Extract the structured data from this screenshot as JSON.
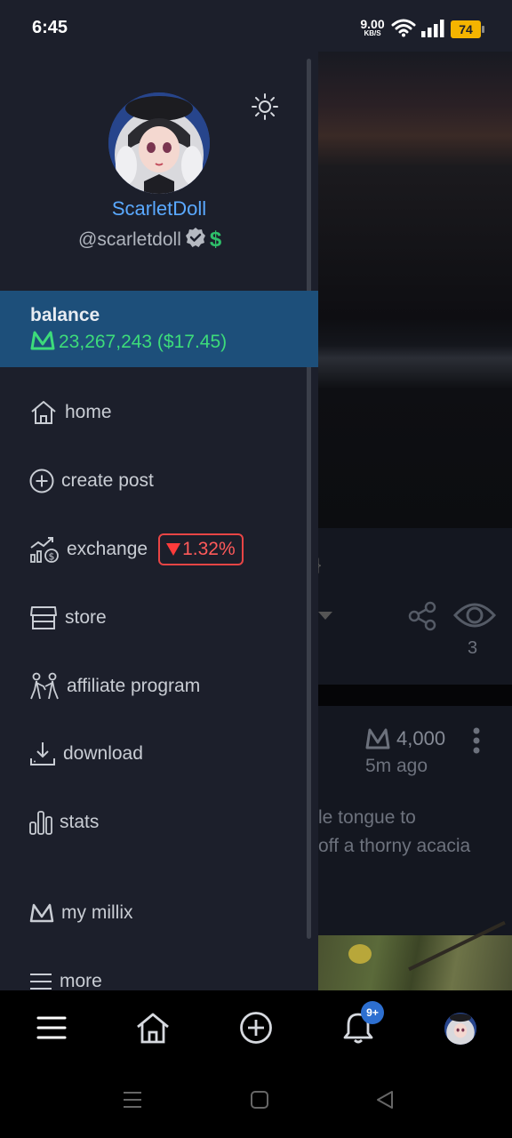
{
  "status_bar": {
    "time": "6:45",
    "net_speed_value": "9.00",
    "net_speed_unit": "KB/S",
    "battery": "74"
  },
  "profile": {
    "display_name": "ScarletDoll",
    "handle": "@scarletdoll",
    "dollar_icon": "$"
  },
  "balance": {
    "label": "balance",
    "value": "23,267,243 ($17.45)"
  },
  "menu": {
    "home": "home",
    "create_post": "create post",
    "exchange": "exchange",
    "exchange_change": "1.32%",
    "store": "store",
    "affiliate": "affiliate program",
    "download": "download",
    "stats": "stats",
    "my_millix": "my millix",
    "more": "more"
  },
  "feed": {
    "post1_views": "3",
    "post2_amount": "4,000",
    "post2_time": "5m ago",
    "post2_text_line1": "le tongue to",
    "post2_text_line2": "off a thorny acacia"
  },
  "bottom_nav": {
    "notification_badge": "9+"
  },
  "colors": {
    "drawer_bg": "#1c1f2b",
    "balance_bg": "#1d4f7a",
    "accent_blue": "#5aa9ff",
    "positive_green": "#3ddc7a",
    "negative_red": "#ff3b3b"
  },
  "icons": [
    "wifi-icon",
    "signal-icon",
    "sun-icon",
    "verified-icon",
    "millix-icon",
    "home-icon",
    "plus-circle-icon",
    "exchange-icon",
    "store-icon",
    "affiliate-icon",
    "download-icon",
    "stats-icon",
    "menu-icon",
    "bell-icon",
    "share-icon",
    "eye-icon",
    "more-vert-icon"
  ]
}
